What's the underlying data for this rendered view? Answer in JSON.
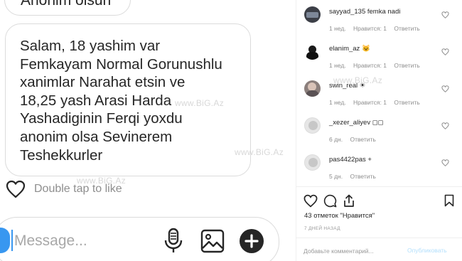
{
  "chat": {
    "prev_message": "Anonim olsun",
    "message": "Salam, 18 yashim var\nFemkayam Normal Gorunushlu\nxanimlar Narahat etsin ve\n18,25 yash Arasi Harda\nYashadiginin Ferqi yoxdu\nanonim olsa Sevinerem\nTeshekkurler",
    "like_hint": "Double tap to like",
    "input_placeholder": "Message..."
  },
  "watermark": "www.BiG.Az",
  "comments": [
    {
      "username": "sayyad_135",
      "text": "femka nadi",
      "time": "1 нед.",
      "likes": "Нравится: 1",
      "reply": "Ответить",
      "avatar": "dark"
    },
    {
      "username": "elanim_az",
      "text": "😺",
      "time": "1 нед.",
      "likes": "Нравится: 1",
      "reply": "Ответить",
      "avatar": "dark"
    },
    {
      "username": "swin_real",
      "text": "☀",
      "time": "1 нед.",
      "likes": "Нравится: 1",
      "reply": "Ответить",
      "avatar": "photo"
    },
    {
      "username": "_xezer_aliyev",
      "text": "◻◻",
      "time": "6 дн.",
      "likes": "",
      "reply": "Ответить",
      "avatar": "default"
    },
    {
      "username": "pas4422pas",
      "text": "+",
      "time": "5 дн.",
      "likes": "",
      "reply": "Ответить",
      "avatar": "default"
    }
  ],
  "post": {
    "likes_text": "43 отметок \"Нравится\"",
    "time_text": "7 ДНЕЙ НАЗАД",
    "add_comment_placeholder": "Добавьте комментарий...",
    "publish_label": "Опубликовать"
  },
  "colors": {
    "accent": "#3897f0",
    "publish_disabled": "#b2dffc",
    "border": "#dbdbdb",
    "muted_text": "#8e8e8e"
  },
  "icons": [
    "heart-icon",
    "camera-icon",
    "microphone-icon",
    "gallery-icon",
    "plus-icon",
    "comment-icon",
    "share-icon",
    "bookmark-icon"
  ]
}
